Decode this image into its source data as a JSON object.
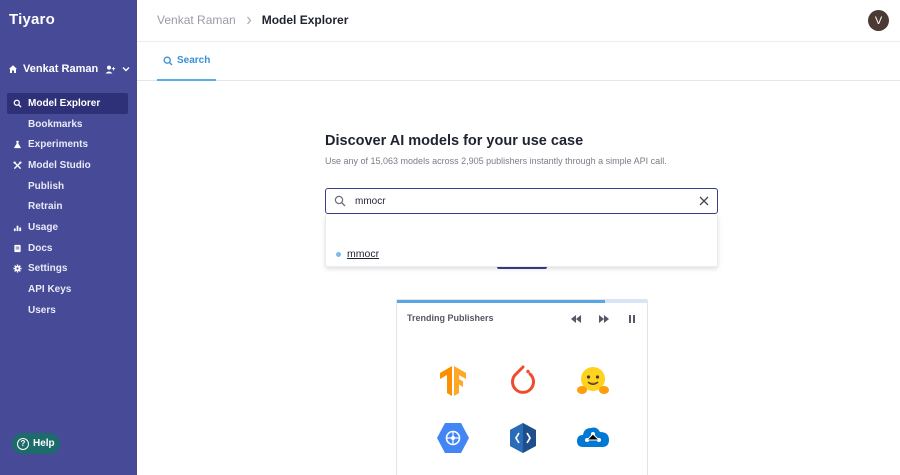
{
  "app": {
    "name": "Tiyaro"
  },
  "user": {
    "name": "Venkat Raman",
    "avatar_initial": "V"
  },
  "sidebar": {
    "items": [
      {
        "label": "Model Explorer",
        "icon": "search-icon",
        "active": true
      },
      {
        "label": "Bookmarks",
        "icon": "",
        "sub": true
      },
      {
        "label": "Experiments",
        "icon": "flask-icon"
      },
      {
        "label": "Model Studio",
        "icon": "tools-icon"
      },
      {
        "label": "Publish",
        "icon": "",
        "sub": true
      },
      {
        "label": "Retrain",
        "icon": "",
        "sub": true
      },
      {
        "label": "Usage",
        "icon": "bar-chart-icon"
      },
      {
        "label": "Docs",
        "icon": "document-icon"
      },
      {
        "label": "Settings",
        "icon": "gear-icon"
      },
      {
        "label": "API Keys",
        "icon": "",
        "sub": true
      },
      {
        "label": "Users",
        "icon": "",
        "sub": true
      }
    ],
    "help_label": "Help"
  },
  "header": {
    "breadcrumb_root": "Venkat Raman",
    "breadcrumb_current": "Model Explorer"
  },
  "tabs": [
    {
      "label": "Search",
      "icon": "search-icon",
      "active": true
    }
  ],
  "main": {
    "title": "Discover AI models for your use case",
    "subtitle": "Use any of 15,063 models across 2,905 publishers instantly through a simple API call."
  },
  "search": {
    "value": "mmocr",
    "placeholder": ""
  },
  "suggestions": [
    {
      "label": "mmocr"
    }
  ],
  "trending": {
    "title": "Trending Publishers",
    "progress_fraction": 0.83,
    "publishers": [
      "tensorflow-icon",
      "pytorch-icon",
      "huggingface-icon",
      "google-cloud-icon",
      "azure-devops-icon",
      "azure-ml-icon"
    ]
  },
  "colors": {
    "sidebar_bg": "#464a97",
    "active_item_bg": "#2e3178",
    "accent": "#3a8fd6",
    "help_bg": "#1d6b6b",
    "search_border": "#3b3f8a"
  }
}
